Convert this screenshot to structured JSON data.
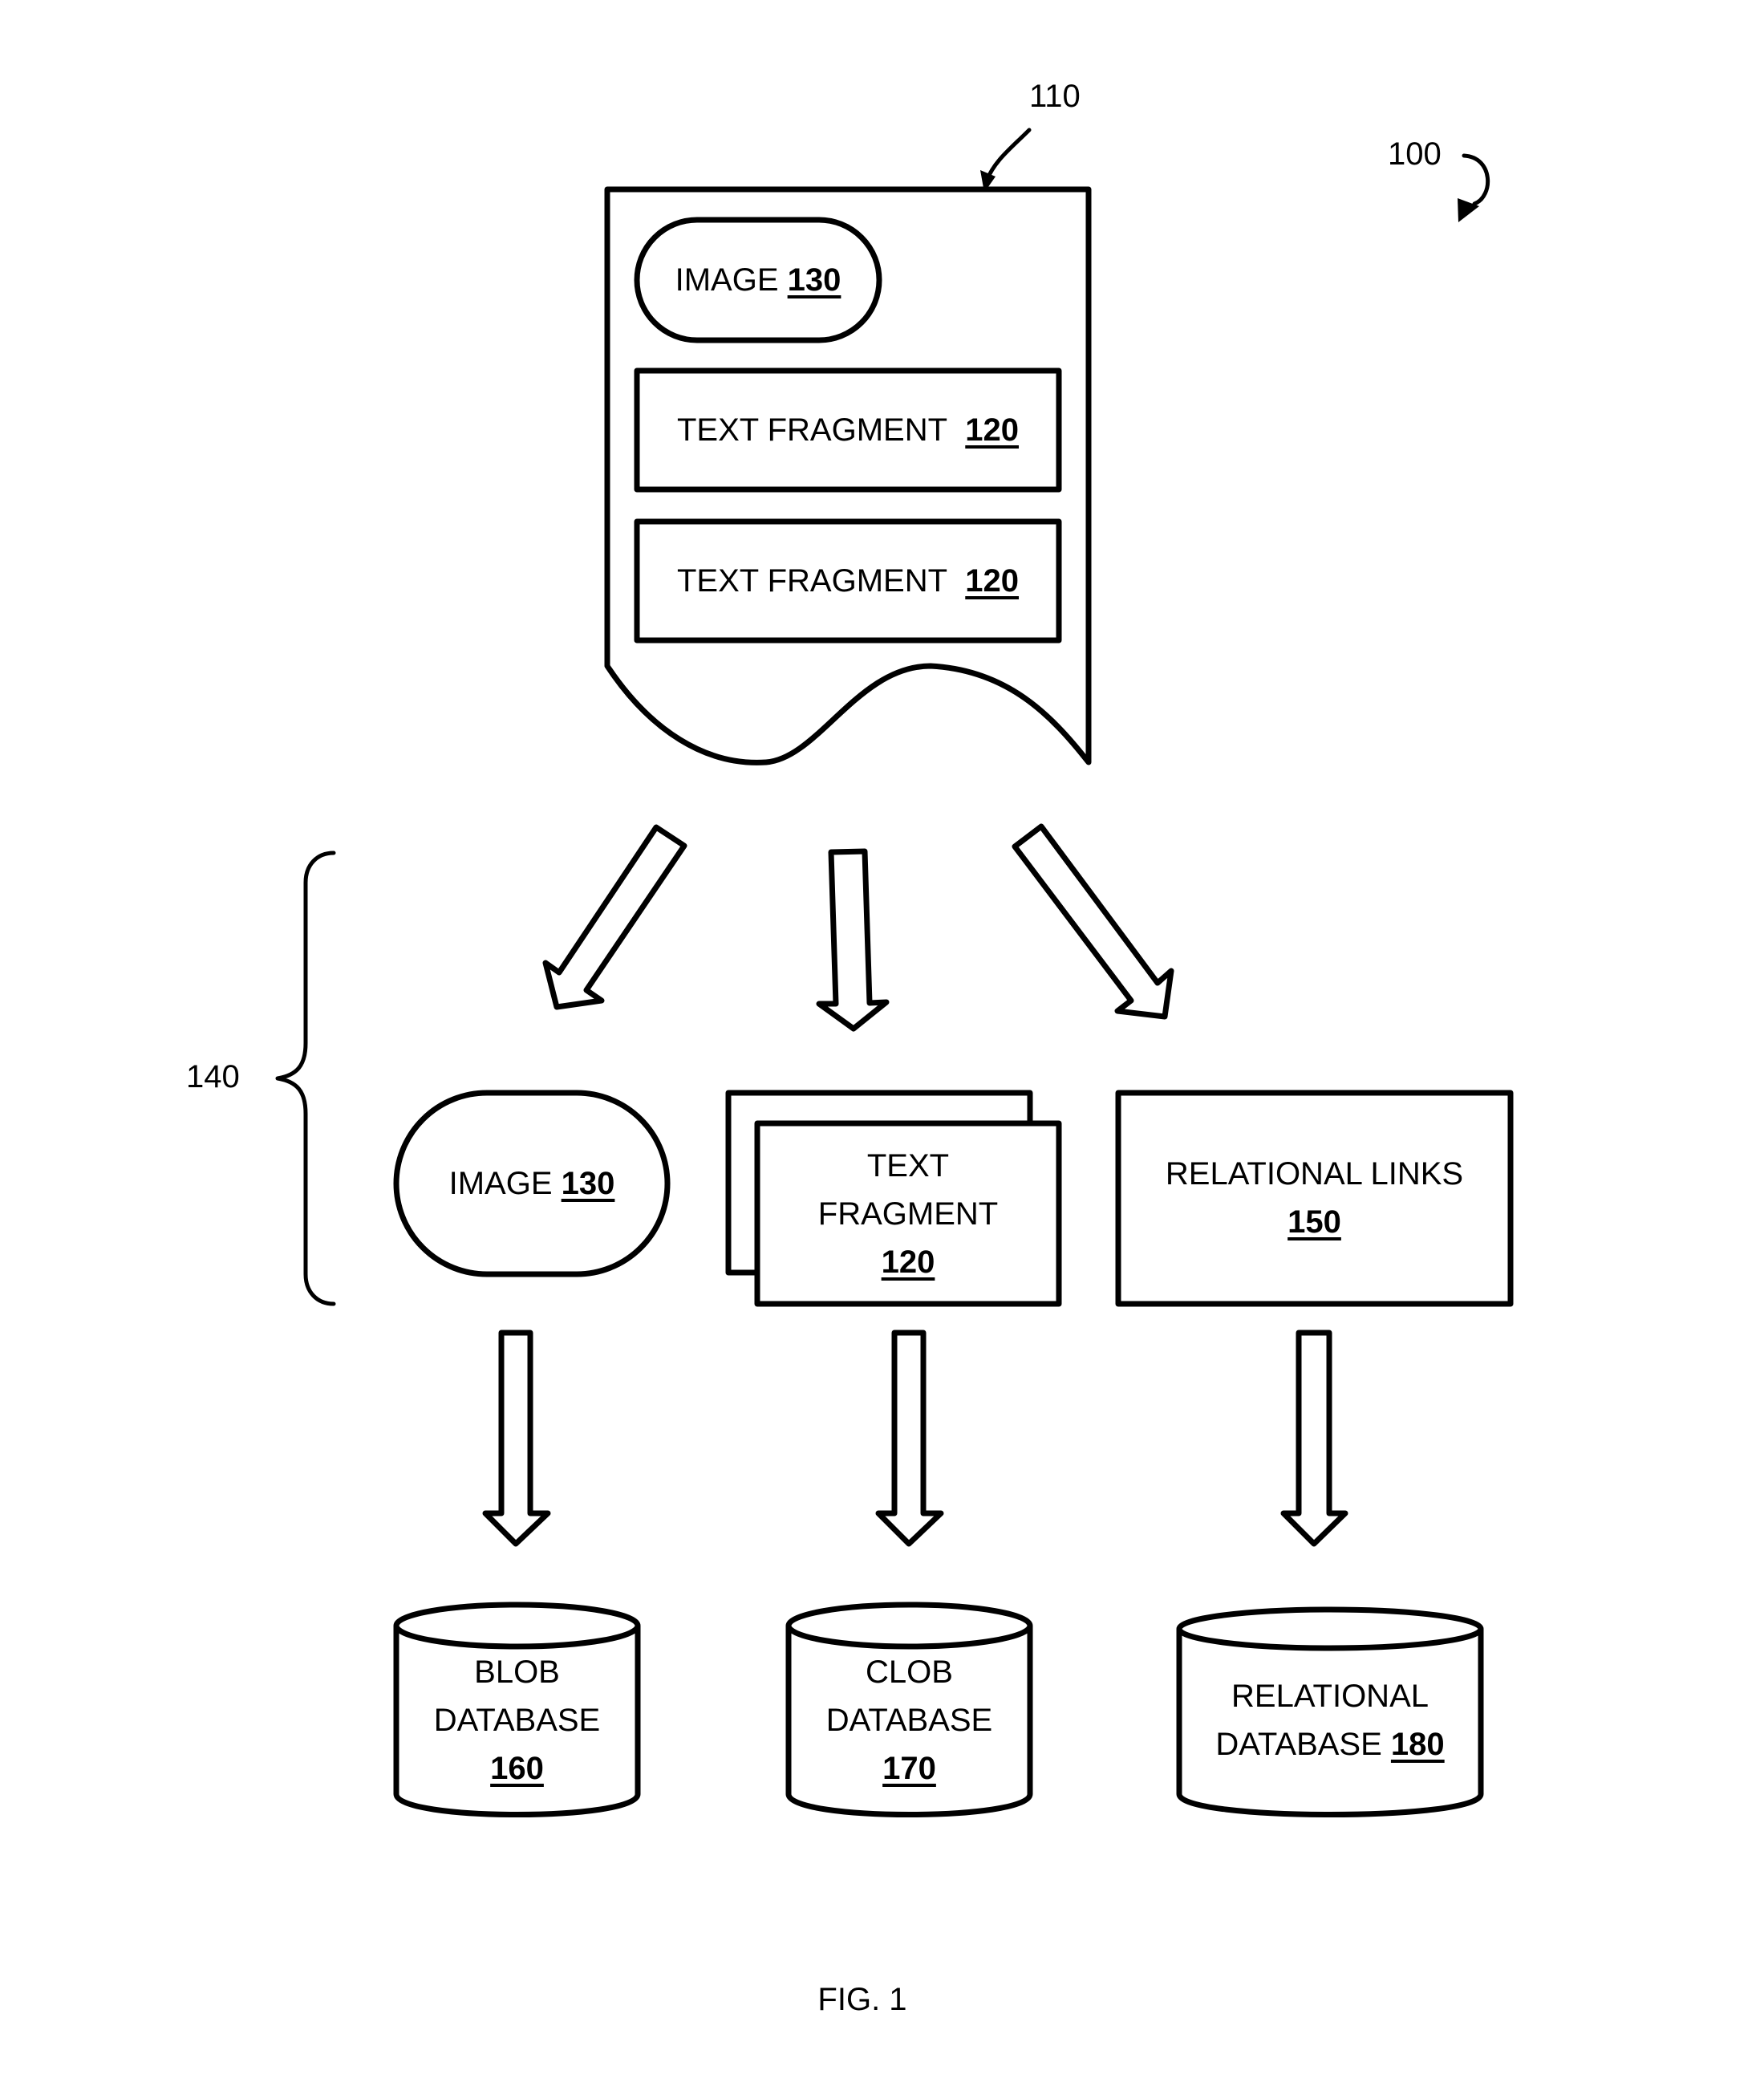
{
  "figure": {
    "caption": "FIG. 1",
    "system_ref": "100",
    "document_ref": "110",
    "components_ref": "140"
  },
  "document": {
    "image": {
      "label": "IMAGE",
      "ref": "130"
    },
    "text_fragments": [
      {
        "label": "TEXT FRAGMENT",
        "ref": "120"
      },
      {
        "label": "TEXT FRAGMENT",
        "ref": "120"
      }
    ]
  },
  "components": {
    "image": {
      "label": "IMAGE",
      "ref": "130"
    },
    "text_fragment": {
      "line1": "TEXT",
      "line2": "FRAGMENT",
      "ref": "120"
    },
    "relational_links": {
      "label": "RELATIONAL LINKS",
      "ref": "150"
    }
  },
  "databases": {
    "blob": {
      "line1": "BLOB",
      "line2": "DATABASE",
      "ref": "160"
    },
    "clob": {
      "line1": "CLOB",
      "line2": "DATABASE",
      "ref": "170"
    },
    "relational": {
      "line1": "RELATIONAL",
      "line2": "DATABASE",
      "ref": "180"
    }
  }
}
